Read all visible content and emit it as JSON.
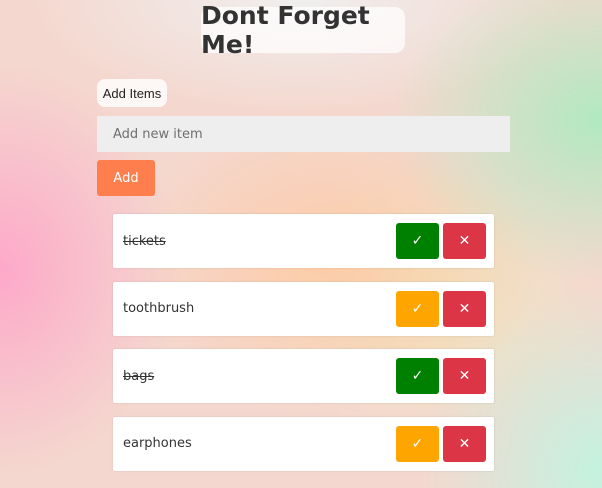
{
  "header": {
    "title": "Dont Forget Me!"
  },
  "form": {
    "label": "Add Items",
    "input_placeholder": "Add new item",
    "input_value": "",
    "add_button_label": "Add"
  },
  "items": [
    {
      "text": "tickets",
      "completed": true,
      "check_icon": "✓",
      "delete_icon": "✕"
    },
    {
      "text": "toothbrush",
      "completed": false,
      "check_icon": "✓",
      "delete_icon": "✕"
    },
    {
      "text": "bags",
      "completed": true,
      "check_icon": "✓",
      "delete_icon": "✕"
    },
    {
      "text": "earphones",
      "completed": false,
      "check_icon": "✓",
      "delete_icon": "✕"
    }
  ],
  "icons": {
    "check": "check-icon",
    "delete": "close-icon"
  },
  "colors": {
    "add_button": "#fe7f4d",
    "completed_check": "#008000",
    "pending_check": "#ffa500",
    "delete": "#dc3545",
    "input_background": "#eeeeee"
  }
}
